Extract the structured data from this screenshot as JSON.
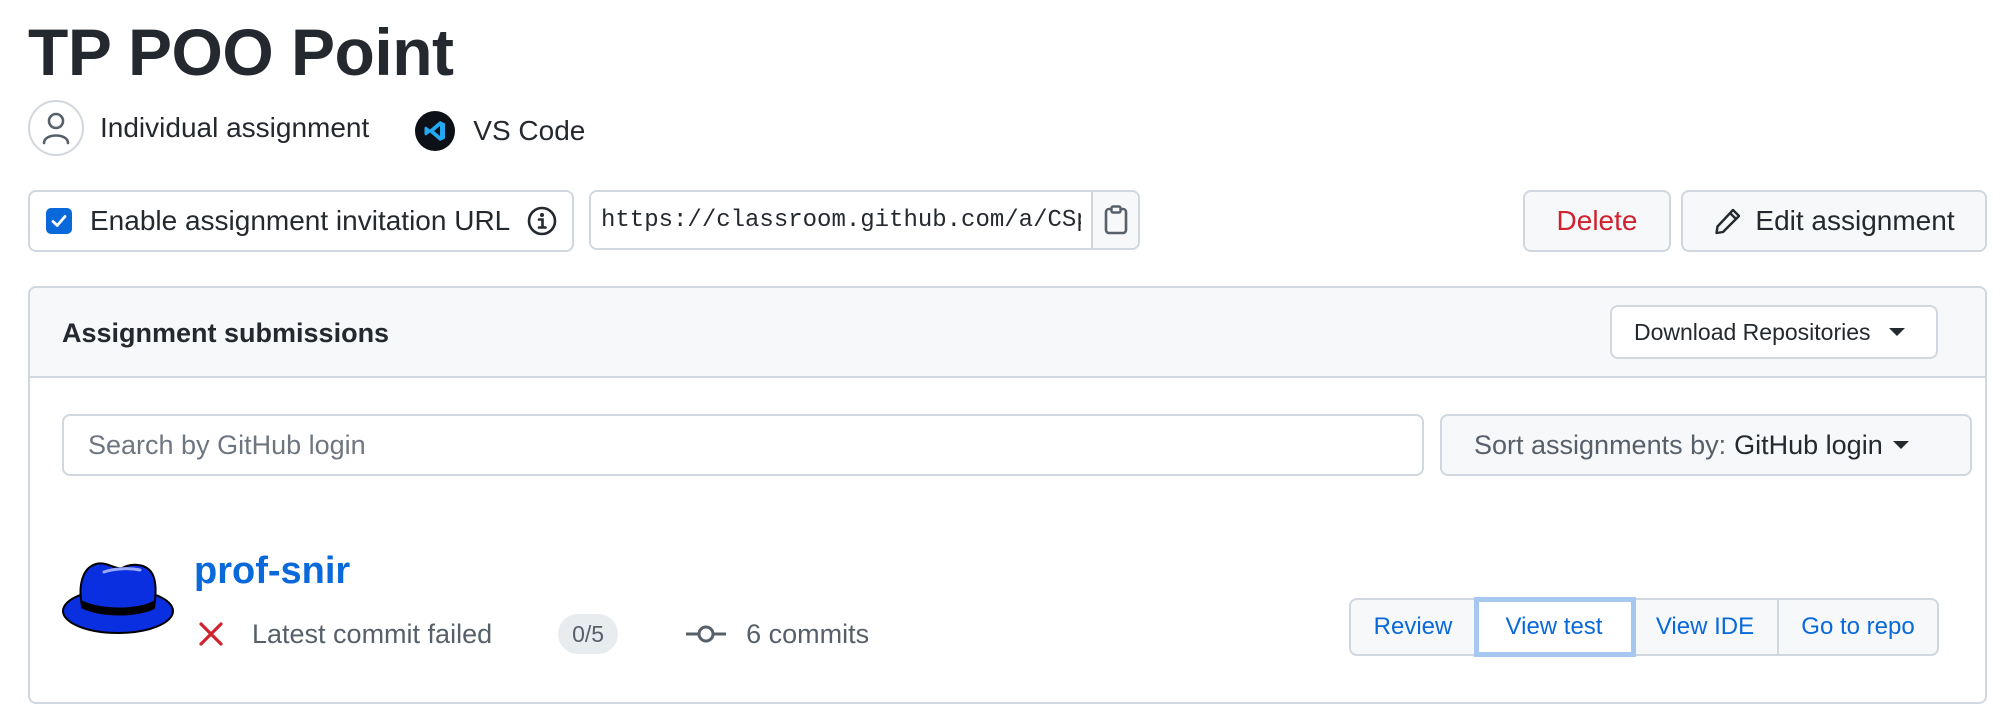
{
  "assignment": {
    "title": "TP POO Point",
    "type_label": "Individual assignment",
    "editor_label": "VS Code"
  },
  "invitation": {
    "enabled": true,
    "label": "Enable assignment invitation URL",
    "url": "https://classroom.github.com/a/CSp"
  },
  "actions": {
    "delete_label": "Delete",
    "edit_label": "Edit assignment"
  },
  "submissions": {
    "header": "Assignment submissions",
    "download_label": "Download Repositories",
    "search_placeholder": "Search by GitHub login",
    "sort_label": "Sort assignments by:",
    "sort_value": "GitHub login",
    "students": [
      {
        "login": "prof-snir",
        "status": "Latest commit failed",
        "score": "0/5",
        "commits": "6 commits",
        "buttons": {
          "review": "Review",
          "view_test": "View test",
          "view_ide": "View IDE",
          "go_to_repo": "Go to repo"
        }
      }
    ]
  },
  "colors": {
    "link": "#0969da",
    "danger": "#cf222e",
    "border": "#d0d7de",
    "hat": "#0a2fe0"
  },
  "icons": {
    "person": "person-icon",
    "vscode": "vscode-icon",
    "info": "info-icon",
    "clipboard": "clipboard-icon",
    "pencil": "pencil-icon",
    "fail": "x-icon",
    "commit": "git-commit-icon",
    "avatar": "fedora-hat-avatar"
  }
}
